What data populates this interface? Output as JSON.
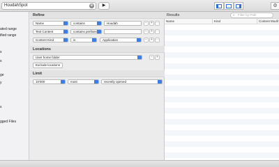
{
  "toolbar": {
    "search_value": "HoudahSpot",
    "clear_glyph": "⊗",
    "run_glyph": "▶",
    "gear_glyph": "⚙"
  },
  "sidebar": {
    "items": [
      "ated range",
      "ified range",
      "s",
      "s",
      "ge",
      "y",
      "",
      "",
      "s",
      "gged Files"
    ]
  },
  "refine": {
    "title": "Refine",
    "criteria": [
      {
        "attribute": "Name",
        "operator": "contains",
        "value": "Houdah",
        "value_type": "text"
      },
      {
        "attribute": "Text Content",
        "operator": "contains prefixes",
        "value": "",
        "value_type": "text"
      },
      {
        "attribute": "Content Kind",
        "operator": "is",
        "value": "Application",
        "value_type": "popup"
      }
    ],
    "minus_glyph": "−",
    "plus_glyph": "+",
    "more_glyph": "⋯"
  },
  "locations": {
    "title": "Locations",
    "folder": "User home folder",
    "exclude_label": "Exclude locations"
  },
  "limit": {
    "title": "Limit",
    "count": "10'000",
    "order": "most",
    "sort": "recently opened"
  },
  "results": {
    "title": "Results",
    "filter_placeholder": "Filter by Path",
    "columns": [
      "Name",
      "Kind",
      "Content Modif"
    ]
  },
  "colors": {
    "accent": "#3b7ee8",
    "toolbar_bg": "#dcdcdc",
    "sidebar_bg": "#f2f2f4"
  }
}
